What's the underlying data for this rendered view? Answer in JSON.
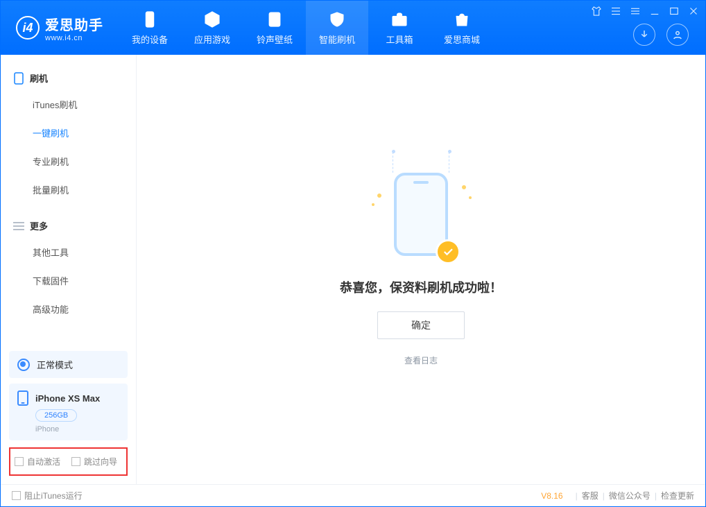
{
  "brand": {
    "name_cn": "爱思助手",
    "url": "www.i4.cn",
    "logo_letter": "i4"
  },
  "nav": [
    {
      "label": "我的设备"
    },
    {
      "label": "应用游戏"
    },
    {
      "label": "铃声壁纸"
    },
    {
      "label": "智能刷机"
    },
    {
      "label": "工具箱"
    },
    {
      "label": "爱思商城"
    }
  ],
  "sidebar": {
    "group1": {
      "title": "刷机",
      "items": [
        "iTunes刷机",
        "一键刷机",
        "专业刷机",
        "批量刷机"
      ]
    },
    "group2": {
      "title": "更多",
      "items": [
        "其他工具",
        "下载固件",
        "高级功能"
      ]
    }
  },
  "status_card": {
    "label": "正常模式"
  },
  "device_card": {
    "name": "iPhone XS Max",
    "capacity": "256GB",
    "subtype": "iPhone"
  },
  "options": {
    "opt1": "自动激活",
    "opt2": "跳过向导"
  },
  "main": {
    "success_title": "恭喜您，保资料刷机成功啦！",
    "ok_btn": "确定",
    "view_log": "查看日志"
  },
  "footer": {
    "block_itunes": "阻止iTunes运行",
    "version": "V8.16",
    "links": [
      "客服",
      "微信公众号",
      "检查更新"
    ]
  }
}
